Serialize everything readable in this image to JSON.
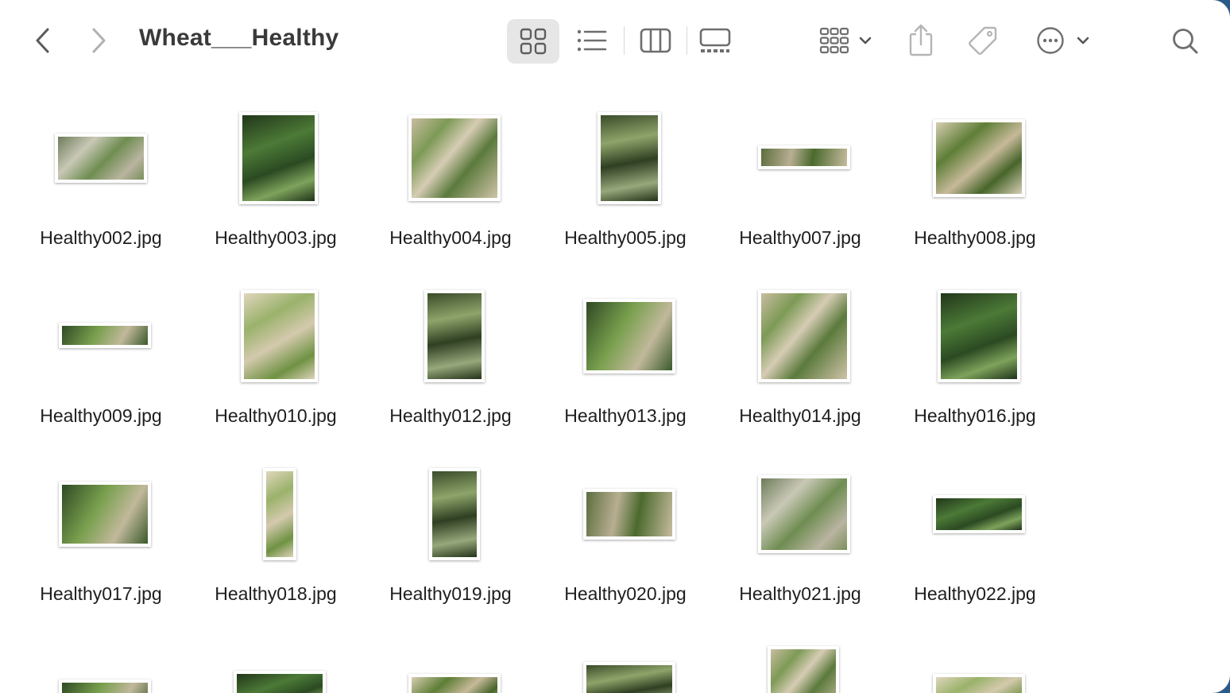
{
  "window": {
    "title": "Wheat___Healthy"
  },
  "toolbar": {
    "back_icon": "chevron-left-icon",
    "forward_icon": "chevron-right-icon",
    "view_buttons": [
      "icon-view",
      "list-view",
      "column-view",
      "gallery-view"
    ],
    "group_icon": "group-by-icon",
    "share_icon": "share-icon",
    "tag_icon": "tag-icon",
    "more_icon": "more-actions-icon",
    "search_icon": "search-icon"
  },
  "files": [
    {
      "name": "Healthy002.jpg"
    },
    {
      "name": "Healthy003.jpg"
    },
    {
      "name": "Healthy004.jpg"
    },
    {
      "name": "Healthy005.jpg"
    },
    {
      "name": "Healthy007.jpg"
    },
    {
      "name": "Healthy008.jpg"
    },
    {
      "name": "Healthy009.jpg"
    },
    {
      "name": "Healthy010.jpg"
    },
    {
      "name": "Healthy012.jpg"
    },
    {
      "name": "Healthy013.jpg"
    },
    {
      "name": "Healthy014.jpg"
    },
    {
      "name": "Healthy016.jpg"
    },
    {
      "name": "Healthy017.jpg"
    },
    {
      "name": "Healthy018.jpg"
    },
    {
      "name": "Healthy019.jpg"
    },
    {
      "name": "Healthy020.jpg"
    },
    {
      "name": "Healthy021.jpg"
    },
    {
      "name": "Healthy022.jpg"
    }
  ],
  "colors": {
    "selected_view_bg": "#e6e6e6",
    "icon_gray": "#6e6e6e",
    "text": "#1e1e1e"
  }
}
